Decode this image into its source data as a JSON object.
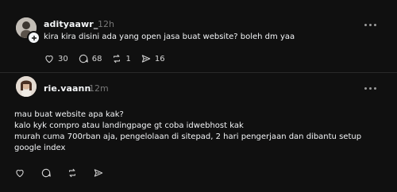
{
  "posts": [
    {
      "username": "adityaawr_",
      "time": "12h",
      "text_lines": [
        "kira kira disini ada yang open jasa buat website? boleh dm yaa"
      ],
      "likes": "30",
      "comments": "68",
      "reposts": "1",
      "shares": "16"
    },
    {
      "username": "rie.vaann",
      "time": "12m",
      "text_lines": [
        "mau buat website apa kak?",
        "kalo kyk compro atau landingpage gt coba idwebhost kak",
        "murah cuma 700rban aja, pengelolaan di sitepad, 2 hari pengerjaan dan dibantu setup",
        "google index"
      ]
    }
  ],
  "icons": {
    "like": "heart-icon",
    "comment": "comment-icon",
    "repost": "repost-icon",
    "share": "send-icon",
    "more": "more-dots-icon",
    "follow": "plus-icon"
  },
  "colors": {
    "background": "#101010",
    "text": "#f3f5f7",
    "muted": "#777777",
    "divider": "#2a2a2a"
  }
}
